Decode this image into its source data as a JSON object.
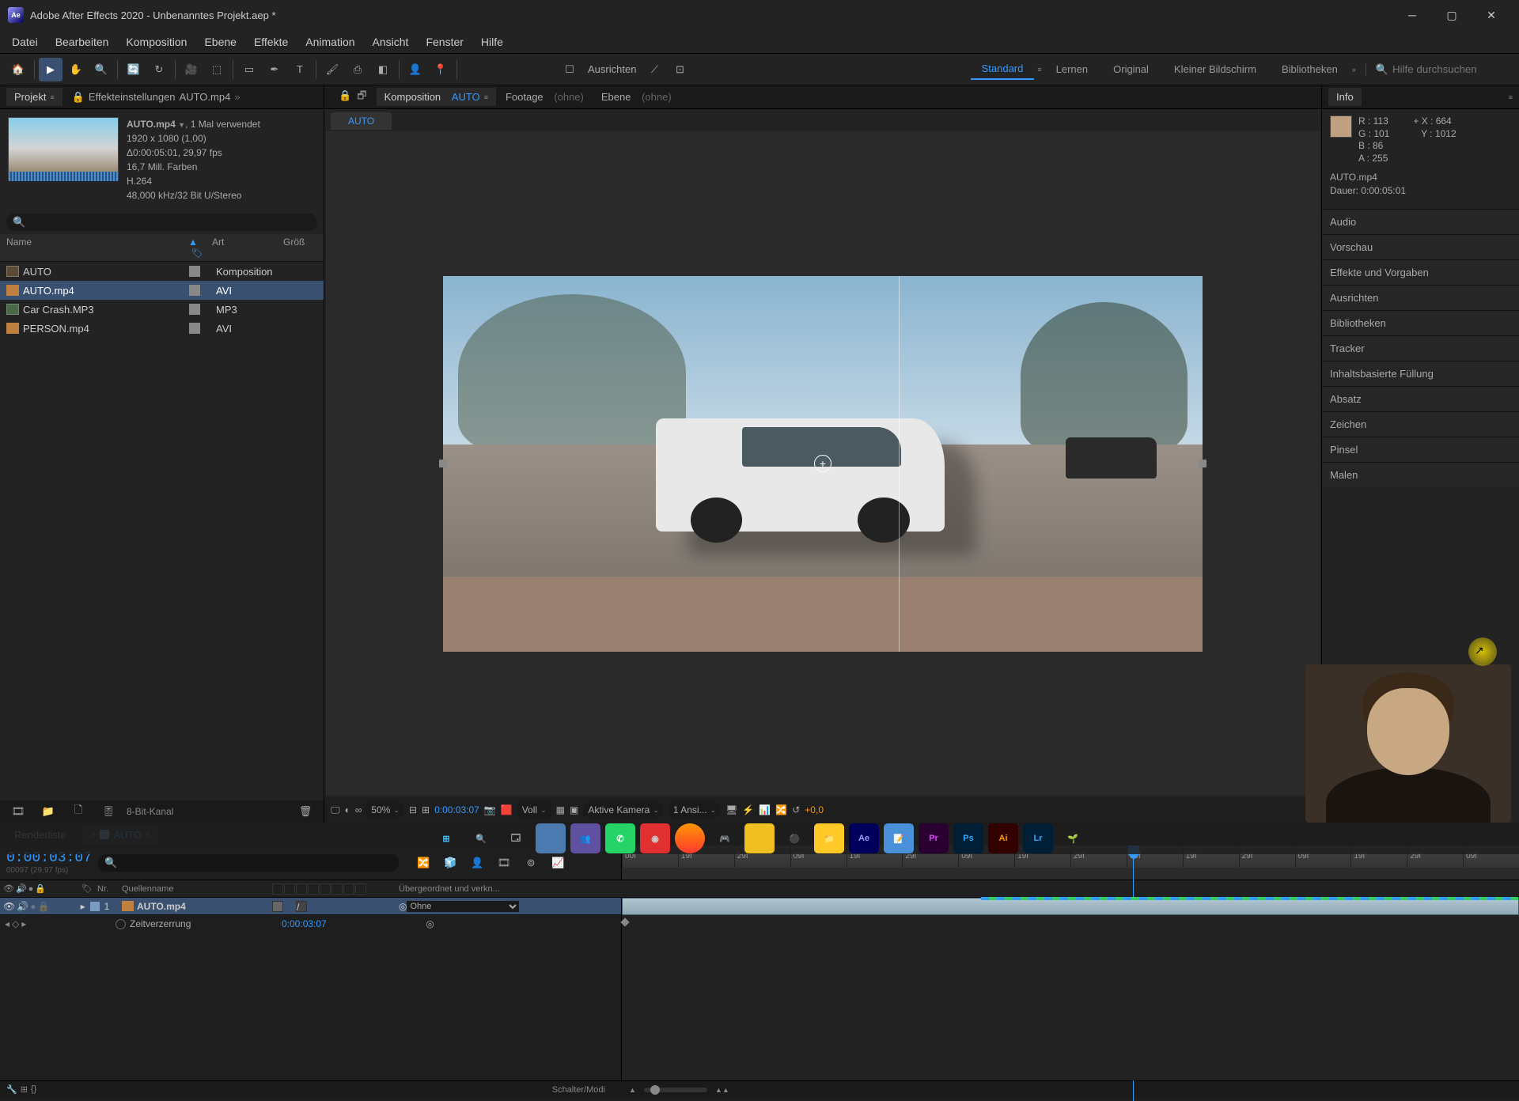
{
  "title": "Adobe After Effects 2020 - Unbenanntes Projekt.aep *",
  "menu": [
    "Datei",
    "Bearbeiten",
    "Komposition",
    "Ebene",
    "Effekte",
    "Animation",
    "Ansicht",
    "Fenster",
    "Hilfe"
  ],
  "toolbar": {
    "ausrichten": "Ausrichten"
  },
  "workspaces": {
    "items": [
      "Standard",
      "Lernen",
      "Original",
      "Kleiner Bildschirm",
      "Bibliotheken"
    ],
    "search_placeholder": "Hilfe durchsuchen"
  },
  "project_panel": {
    "tab": "Projekt",
    "effect_tab_prefix": "Effekteinstellungen",
    "effect_tab_name": "AUTO.mp4",
    "selected_name": "AUTO.mp4",
    "selected_badge": ", 1 Mal verwendet",
    "meta": [
      "1920 x 1080 (1,00)",
      "Δ0:00:05:01, 29,97 fps",
      "16,7 Mill. Farben",
      "H.264",
      "48,000 kHz/32 Bit U/Stereo"
    ],
    "columns": {
      "name": "Name",
      "art": "Art",
      "size": "Größ"
    },
    "items": [
      {
        "name": "AUTO",
        "art": "Komposition",
        "type": "comp"
      },
      {
        "name": "AUTO.mp4",
        "art": "AVI",
        "type": "vid",
        "selected": true
      },
      {
        "name": "Car Crash.MP3",
        "art": "MP3",
        "type": "aud"
      },
      {
        "name": "PERSON.mp4",
        "art": "AVI",
        "type": "vid"
      }
    ],
    "depth": "8-Bit-Kanal"
  },
  "comp_panel": {
    "tab_prefix": "Komposition",
    "tab_name": "AUTO",
    "footage_prefix": "Footage",
    "footage_val": "(ohne)",
    "layer_prefix": "Ebene",
    "layer_val": "(ohne)",
    "sub_tab": "AUTO",
    "controls": {
      "zoom": "50%",
      "timecode": "0:00:03:07",
      "res": "Voll",
      "camera": "Aktive Kamera",
      "views": "1 Ansi...",
      "exposure": "+0,0"
    }
  },
  "info": {
    "title": "Info",
    "r": "R : 113",
    "g": "G : 101",
    "b": "B : 86",
    "a": "A : 255",
    "x": "X : 664",
    "y": "Y : 1012",
    "file": "AUTO.mp4",
    "duration": "Dauer: 0:00:05:01"
  },
  "right_panels": [
    "Audio",
    "Vorschau",
    "Effekte und Vorgaben",
    "Ausrichten",
    "Bibliotheken",
    "Tracker",
    "Inhaltsbasierte Füllung",
    "Absatz",
    "Zeichen",
    "Pinsel",
    "Malen"
  ],
  "timeline": {
    "render_tab": "Renderliste",
    "comp_tab": "AUTO",
    "timecode": "0:00:03:07",
    "timecode_sub": "00097 (29,97 fps)",
    "ticks": [
      "00f",
      "19f",
      "29f",
      "09f",
      "19f",
      "29f",
      "09f",
      "19f",
      "29f",
      "09f",
      "19f",
      "29f",
      "09f",
      "19f",
      "29f",
      "09f"
    ],
    "playhead_pct": 57,
    "cols": {
      "nr": "Nr.",
      "quelle": "Quellenname",
      "parent": "Übergeordnet und verkn..."
    },
    "layer": {
      "num": "1",
      "name": "AUTO.mp4",
      "parent": "Ohne",
      "prop": "Zeitverzerrung",
      "prop_val": "0:00:03:07"
    },
    "footer": "Schalter/Modi"
  }
}
